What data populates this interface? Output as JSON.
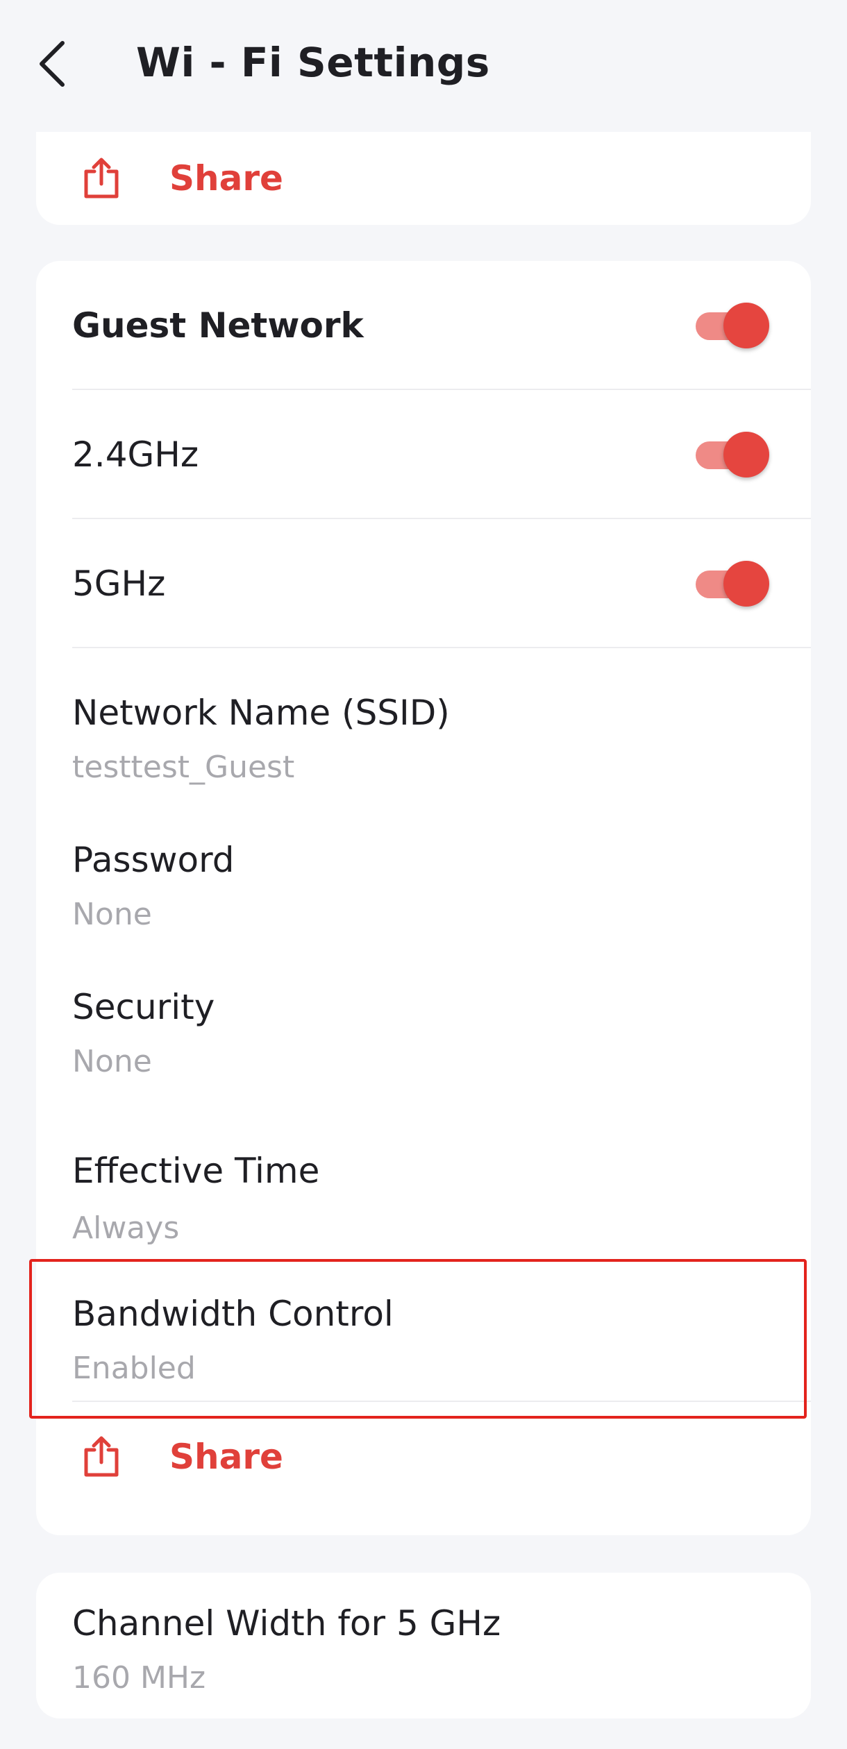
{
  "header": {
    "title": "Wi - Fi Settings"
  },
  "top_card": {
    "share_label": "Share"
  },
  "guest_card": {
    "guest_network": {
      "label": "Guest Network",
      "enabled": true
    },
    "band_24": {
      "label": "2.4GHz",
      "enabled": true
    },
    "band_5": {
      "label": "5GHz",
      "enabled": true
    },
    "ssid": {
      "label": "Network Name (SSID)",
      "value": "testtest_Guest"
    },
    "password": {
      "label": "Password",
      "value": "None"
    },
    "security": {
      "label": "Security",
      "value": "None"
    },
    "effective_time": {
      "label": "Effective Time",
      "value": "Always"
    },
    "bandwidth_control": {
      "label": "Bandwidth Control",
      "value": "Enabled"
    },
    "share_label": "Share"
  },
  "channel_card": {
    "label": "Channel Width for 5 GHz",
    "value": "160 MHz"
  },
  "colors": {
    "accent": "#e0403a",
    "toggle_track": "#ef8a86",
    "toggle_knob": "#e5453f",
    "highlight_border": "#e3231d",
    "background": "#f5f6f9"
  }
}
